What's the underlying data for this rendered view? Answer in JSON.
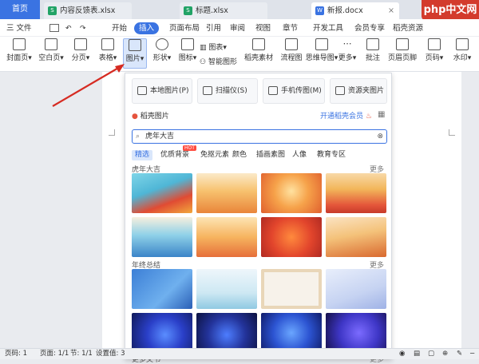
{
  "tabs": {
    "home": "首页",
    "doc1": "内容反馈表.xlsx",
    "doc2": "标题.xlsx",
    "doc3": "新报.docx"
  },
  "watermark": "php中文网",
  "menu": {
    "file": "三 文件",
    "items": [
      "开始",
      "插入",
      "页面布局",
      "引用",
      "审阅",
      "视图",
      "章节",
      "开发工具",
      "会员专享",
      "稻壳资源"
    ],
    "active": "插入"
  },
  "ribbon": {
    "cover": "封面页",
    "blank": "空白页",
    "pagebreak": "分页",
    "table": "表格",
    "picture": "图片",
    "shape": "形状",
    "icon": "图标",
    "chart": "图表",
    "smartart": "智能图形",
    "daoke": "稻壳素材",
    "flow": "流程图",
    "mindmap": "思维导图",
    "more": "更多",
    "comment": "批注",
    "header": "页眉页脚",
    "pagenum": "页码",
    "watermark": "水印"
  },
  "panel": {
    "local": "本地图片(P)",
    "scan": "扫描仪(S)",
    "phone": "手机传图(M)",
    "resource": "资源夹图片",
    "stock": "稻壳图片",
    "vip": "开通稻壳会员",
    "search_value": "虎年大吉",
    "categories": [
      "精选",
      "优质背景",
      "免抠元素",
      "颜色",
      "插画素图",
      "人像",
      "教育专区"
    ],
    "hot": "HOT",
    "section1": "虎年大吉",
    "section2": "年终总结",
    "section3": "更多文书",
    "more": "更多"
  },
  "status": {
    "page": "页码: 1",
    "pages": "页面: 1/1",
    "section": "节: 1/1",
    "settings": "设置值: 3"
  },
  "colors": {
    "accent": "#3a73e2",
    "watermark": "#d33b2c"
  }
}
